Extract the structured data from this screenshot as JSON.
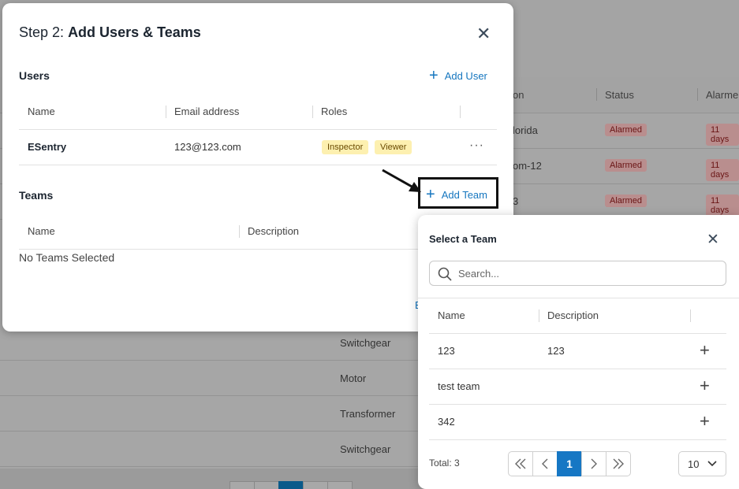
{
  "background": {
    "headers": [
      "on",
      "Status",
      "Alarme"
    ],
    "rows": [
      {
        "location": "lorida",
        "status": "Alarmed",
        "alarmed": "11 days"
      },
      {
        "location": "om-12",
        "status": "Alarmed",
        "alarmed": "11 days"
      },
      {
        "location": "3",
        "status": "Alarmed",
        "alarmed": "11 days"
      }
    ],
    "asset_types": [
      "Switchgear",
      "Motor",
      "Transformer",
      "Switchgear"
    ],
    "hidden_link": "E"
  },
  "modal": {
    "title_prefix": "Step 2:",
    "title_bold": "Add Users & Teams",
    "users": {
      "title": "Users",
      "add_label": "Add User",
      "columns": [
        "Name",
        "Email address",
        "Roles"
      ],
      "rows": [
        {
          "name": "ESentry",
          "email": "123@123.com",
          "roles": [
            "Inspector",
            "Viewer"
          ],
          "actions": "···"
        }
      ]
    },
    "teams": {
      "title": "Teams",
      "add_label": "Add Team",
      "columns": [
        "Name",
        "Description"
      ],
      "empty_text": "No Teams Selected"
    }
  },
  "panel": {
    "title": "Select a Team",
    "search_placeholder": "Search...",
    "columns": [
      "Name",
      "Description"
    ],
    "rows": [
      {
        "name": "123",
        "description": "123"
      },
      {
        "name": "test team",
        "description": ""
      },
      {
        "name": "342",
        "description": ""
      }
    ],
    "total": "Total: 3",
    "current_page": "1",
    "page_size": "10"
  },
  "colors": {
    "accent": "#1576bf",
    "role_tag_bg": "#fdf0b0",
    "alarm_badge_bg": "#b98e8e"
  }
}
